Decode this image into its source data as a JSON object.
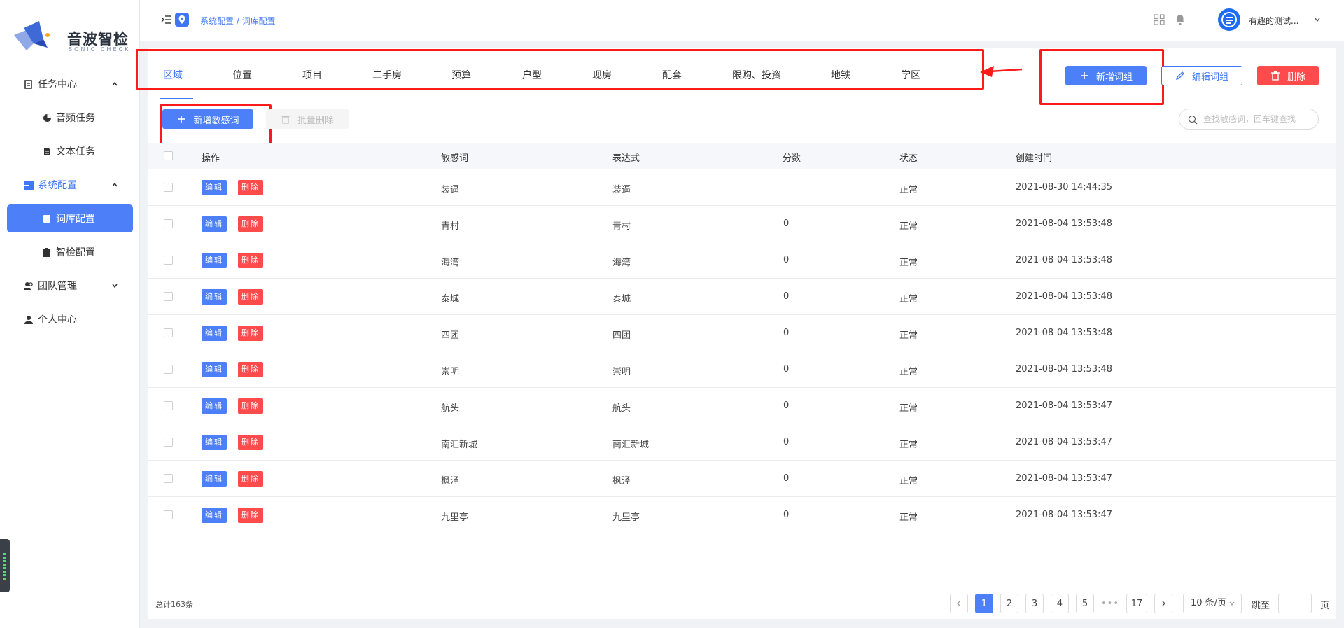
{
  "app": {
    "logo_text": "音波智检",
    "logo_sub": "SONIC CHECK"
  },
  "sidebar": {
    "items": [
      {
        "label": "任务中心",
        "icon": "task-center-icon",
        "expanded": true
      },
      {
        "label": "音频任务",
        "icon": "audio-task-icon"
      },
      {
        "label": "文本任务",
        "icon": "text-task-icon"
      },
      {
        "label": "系统配置",
        "icon": "system-config-icon",
        "expanded": true
      },
      {
        "label": "词库配置",
        "icon": "lexicon-icon",
        "active": true
      },
      {
        "label": "智检配置",
        "icon": "smart-check-icon"
      },
      {
        "label": "团队管理",
        "icon": "team-icon",
        "expanded": false
      },
      {
        "label": "个人中心",
        "icon": "user-icon"
      }
    ]
  },
  "header": {
    "breadcrumb": "系统配置 / 词库配置",
    "user_name": "有趣的测试..."
  },
  "tabs": [
    "区域",
    "位置",
    "项目",
    "二手房",
    "预算",
    "户型",
    "现房",
    "配套",
    "限购、投资",
    "地铁",
    "学区"
  ],
  "active_tab": "区域",
  "group_actions": {
    "add_group": "新增词组",
    "edit_group": "编辑词组",
    "delete": "删除"
  },
  "toolbar": {
    "add_word": "新增敏感词",
    "batch_delete": "批量删除"
  },
  "search": {
    "placeholder": "查找敏感词，回车键查找"
  },
  "table": {
    "columns": [
      "操作",
      "敏感词",
      "表达式",
      "分数",
      "状态",
      "创建时间"
    ],
    "action_edit": "编辑",
    "action_delete": "删除",
    "rows": [
      {
        "word": "装逼",
        "expr": "装逼",
        "score": "",
        "status": "正常",
        "created": "2021-08-30 14:44:35"
      },
      {
        "word": "青村",
        "expr": "青村",
        "score": "0",
        "status": "正常",
        "created": "2021-08-04 13:53:48"
      },
      {
        "word": "海湾",
        "expr": "海湾",
        "score": "0",
        "status": "正常",
        "created": "2021-08-04 13:53:48"
      },
      {
        "word": "泰城",
        "expr": "泰城",
        "score": "0",
        "status": "正常",
        "created": "2021-08-04 13:53:48"
      },
      {
        "word": "四团",
        "expr": "四团",
        "score": "0",
        "status": "正常",
        "created": "2021-08-04 13:53:48"
      },
      {
        "word": "崇明",
        "expr": "崇明",
        "score": "0",
        "status": "正常",
        "created": "2021-08-04 13:53:48"
      },
      {
        "word": "航头",
        "expr": "航头",
        "score": "0",
        "status": "正常",
        "created": "2021-08-04 13:53:47"
      },
      {
        "word": "南汇新城",
        "expr": "南汇新城",
        "score": "0",
        "status": "正常",
        "created": "2021-08-04 13:53:47"
      },
      {
        "word": "枫泾",
        "expr": "枫泾",
        "score": "0",
        "status": "正常",
        "created": "2021-08-04 13:53:47"
      },
      {
        "word": "九里亭",
        "expr": "九里亭",
        "score": "0",
        "status": "正常",
        "created": "2021-08-04 13:53:47"
      }
    ]
  },
  "pagination": {
    "total": "总计163条",
    "pages": [
      "1",
      "2",
      "3",
      "4",
      "5",
      "•••",
      "17"
    ],
    "current": "1",
    "page_size": "10 条/页",
    "jump_label": "跳至",
    "page_suffix": "页"
  },
  "colors": {
    "accent": "#4c7ff8",
    "danger": "#ff4b4b",
    "annotation": "#ff1a1a"
  }
}
